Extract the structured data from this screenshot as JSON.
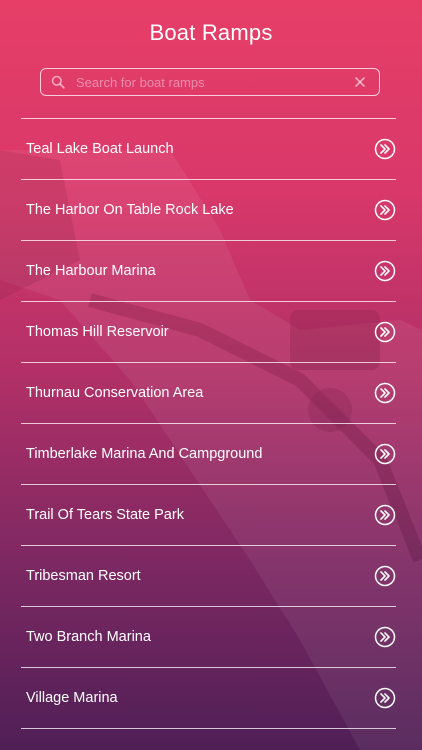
{
  "header": {
    "title": "Boat Ramps"
  },
  "search": {
    "placeholder": "Search for boat ramps",
    "value": "",
    "icon": "search-icon",
    "clear_icon": "close-icon"
  },
  "ramps": {
    "items": [
      {
        "label": "Teal Lake Boat Launch"
      },
      {
        "label": "The Harbor On Table Rock Lake"
      },
      {
        "label": "The Harbour Marina"
      },
      {
        "label": "Thomas Hill Reservoir"
      },
      {
        "label": "Thurnau Conservation Area"
      },
      {
        "label": "Timberlake Marina And Campground"
      },
      {
        "label": "Trail Of Tears State Park"
      },
      {
        "label": "Tribesman Resort"
      },
      {
        "label": "Two Branch Marina"
      },
      {
        "label": "Village Marina"
      }
    ],
    "item_icon": "double-chevron-right-icon"
  },
  "colors": {
    "gradient_top": "#e63e67",
    "gradient_bottom": "#4f1f56",
    "text": "#ffffff"
  }
}
